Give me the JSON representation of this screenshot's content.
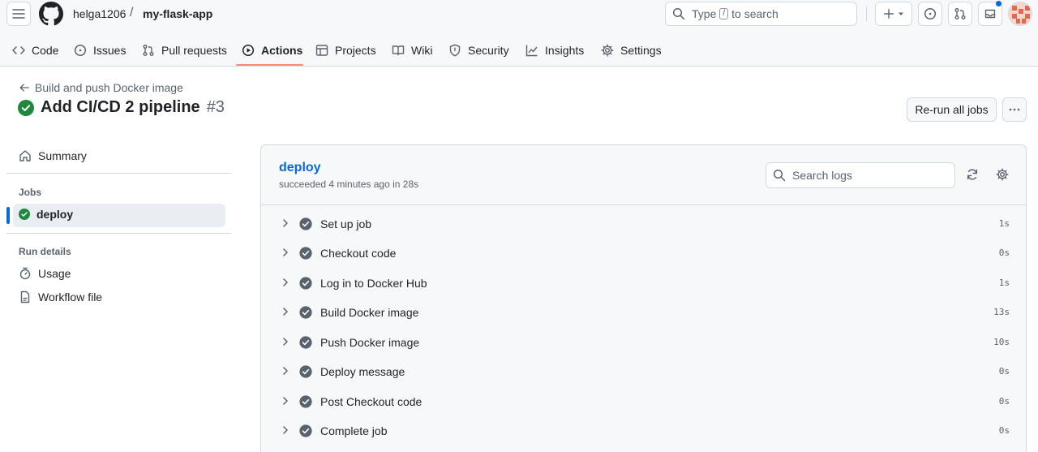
{
  "header": {
    "owner": "helga1206",
    "separator": "/",
    "repo": "my-flask-app",
    "search_prefix": "Type",
    "search_key": "/",
    "search_suffix": "to search"
  },
  "repo_nav": [
    {
      "label": "Code",
      "icon": "code-icon"
    },
    {
      "label": "Issues",
      "icon": "issue-icon"
    },
    {
      "label": "Pull requests",
      "icon": "pull-request-icon"
    },
    {
      "label": "Actions",
      "icon": "play-icon",
      "active": true
    },
    {
      "label": "Projects",
      "icon": "table-icon"
    },
    {
      "label": "Wiki",
      "icon": "book-icon"
    },
    {
      "label": "Security",
      "icon": "shield-icon"
    },
    {
      "label": "Insights",
      "icon": "graph-icon"
    },
    {
      "label": "Settings",
      "icon": "gear-icon"
    }
  ],
  "run": {
    "back_label": "Build and push Docker image",
    "title": "Add CI/CD 2 pipeline",
    "number": "#3",
    "rerun_label": "Re-run all jobs"
  },
  "sidebar": {
    "summary_label": "Summary",
    "jobs_heading": "Jobs",
    "jobs": [
      {
        "label": "deploy",
        "status": "success"
      }
    ],
    "run_details_heading": "Run details",
    "details": [
      {
        "label": "Usage",
        "icon": "stopwatch-icon"
      },
      {
        "label": "Workflow file",
        "icon": "file-icon"
      }
    ]
  },
  "job": {
    "name": "deploy",
    "meta": "succeeded 4 minutes ago in 28s",
    "search_placeholder": "Search logs",
    "steps": [
      {
        "name": "Set up job",
        "duration": "1s"
      },
      {
        "name": "Checkout code",
        "duration": "0s"
      },
      {
        "name": "Log in to Docker Hub",
        "duration": "1s"
      },
      {
        "name": "Build Docker image",
        "duration": "13s"
      },
      {
        "name": "Push Docker image",
        "duration": "10s"
      },
      {
        "name": "Deploy message",
        "duration": "0s"
      },
      {
        "name": "Post Checkout code",
        "duration": "0s"
      },
      {
        "name": "Complete job",
        "duration": "0s"
      }
    ]
  },
  "colors": {
    "success": "#1f883d",
    "link": "#0969da",
    "tab_underline": "#fd8c73",
    "step_check": "#59636e"
  }
}
